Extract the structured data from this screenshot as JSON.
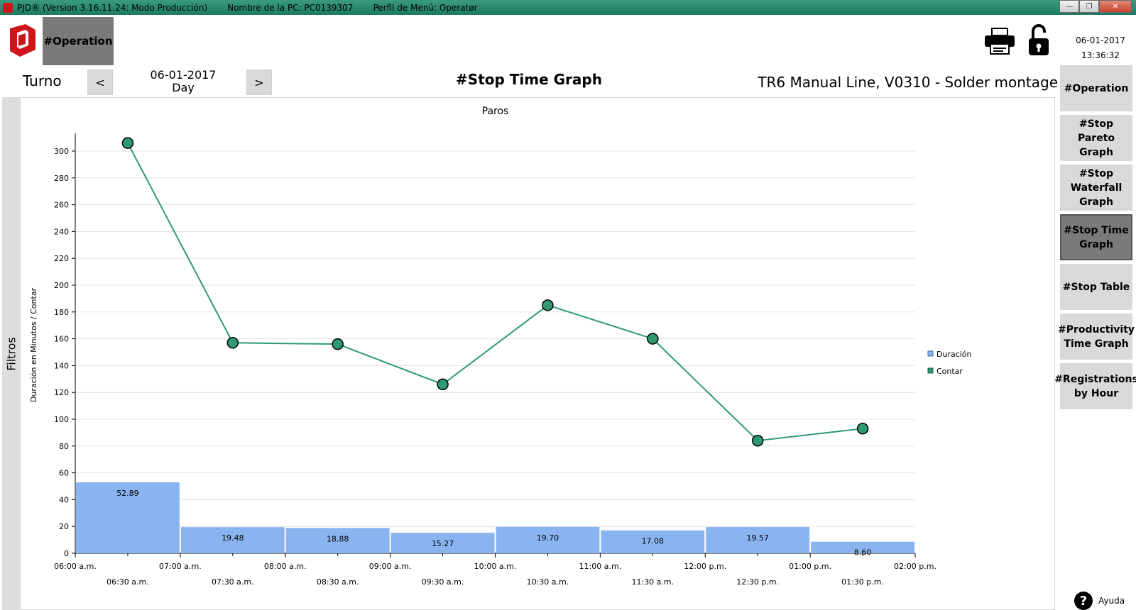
{
  "window": {
    "title_parts": [
      "PJD® (Version 3.16.11.24: Modo Producción)",
      "Nombre de la PC: PC0139307",
      "Perfil de Menú: Operatør"
    ]
  },
  "header": {
    "operation_button": "#Operation",
    "date": "06-01-2017",
    "time": "13:36:32"
  },
  "toolbar": {
    "turno_label": "Turno",
    "prev_label": "<",
    "next_label": ">",
    "selected_date": "06-01-2017",
    "selected_period": "Day",
    "page_title": "#Stop Time Graph",
    "line_title": "TR6 Manual Line, V0310 - Solder montage"
  },
  "filters": {
    "label": "Filtros"
  },
  "sidebar": {
    "items": [
      {
        "label": "#Operation",
        "active": false
      },
      {
        "label": "#Stop Pareto Graph",
        "active": false
      },
      {
        "label": "#Stop Waterfall Graph",
        "active": false
      },
      {
        "label": "#Stop Time Graph",
        "active": true
      },
      {
        "label": "#Stop Table",
        "active": false
      },
      {
        "label": "#Productivity Time Graph",
        "active": false
      },
      {
        "label": "#Registrations by Hour",
        "active": false
      }
    ]
  },
  "help": {
    "label": "Ayuda"
  },
  "colors": {
    "titlebar": "#2a8a6f",
    "bar": "#8ab4f0",
    "line": "#2f9a72",
    "marker": "#2f9a72",
    "button_active": "#7a7a7a",
    "button": "#d9d9d9"
  },
  "icons": [
    "app-logo-icon",
    "printer-icon",
    "unlock-icon",
    "help-icon"
  ],
  "chart_data": {
    "type": "bar",
    "title": "Paros",
    "ylabel": "Duración en Minutos / Contar",
    "xlabel": "",
    "ylim": [
      0,
      300
    ],
    "yticks": [
      0,
      20,
      40,
      60,
      80,
      100,
      120,
      140,
      160,
      180,
      200,
      220,
      240,
      260,
      280,
      300
    ],
    "grid": true,
    "legend_position": "right",
    "x_major_ticks": [
      "06:00 a.m.",
      "07:00 a.m.",
      "08:00 a.m.",
      "09:00 a.m.",
      "10:00 a.m.",
      "11:00 a.m.",
      "12:00 p.m.",
      "01:00 p.m.",
      "02:00 p.m."
    ],
    "categories": [
      "06:30 a.m.",
      "07:30 a.m.",
      "08:30 a.m.",
      "09:30 a.m.",
      "10:30 a.m.",
      "11:30 a.m.",
      "12:30 p.m.",
      "01:30 p.m."
    ],
    "series": [
      {
        "name": "Duración",
        "type": "bar",
        "values": [
          52.89,
          19.48,
          18.88,
          15.27,
          19.7,
          17.08,
          19.57,
          8.6
        ],
        "labels": [
          "52.89",
          "19.48",
          "18.88",
          "15.27",
          "19.70",
          "17.08",
          "19.57",
          "8.60"
        ]
      },
      {
        "name": "Contar",
        "type": "line",
        "values": [
          306,
          157,
          156,
          126,
          185,
          160,
          84,
          93
        ]
      }
    ]
  }
}
